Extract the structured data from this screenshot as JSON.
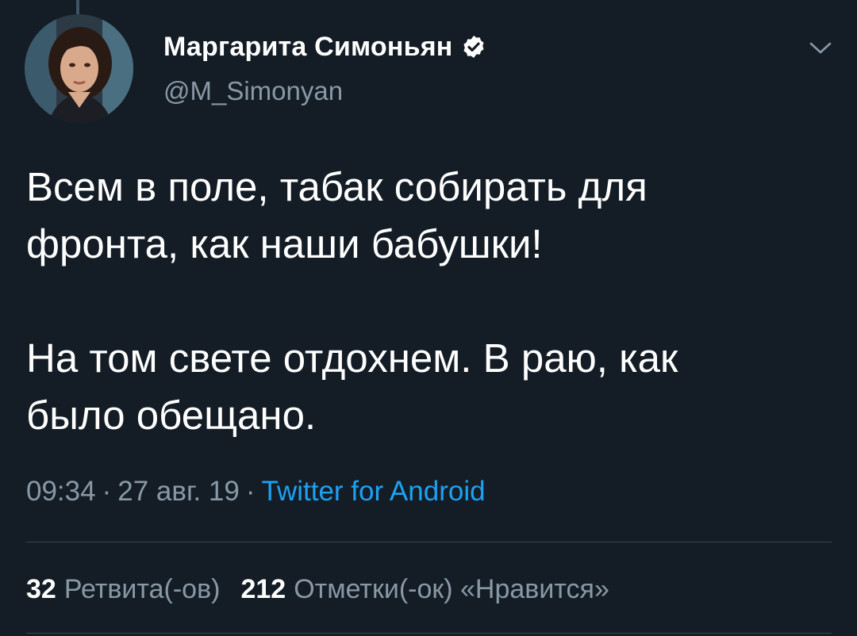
{
  "user": {
    "display_name": "Маргарита Симоньян",
    "handle": "@M_Simonyan",
    "verified": true
  },
  "tweet": {
    "paragraphs": [
      [
        "Всем в поле, табак собирать для",
        "фронта, как наши бабушки!"
      ],
      [
        "На том свете отдохнем. В раю, как",
        "было обещано."
      ]
    ]
  },
  "meta": {
    "time": "09:34",
    "date": "27 авг. 19",
    "separator": "·",
    "source": "Twitter for Android"
  },
  "stats": {
    "retweets_count": "32",
    "retweets_label": "Ретвита(-ов)",
    "likes_count": "212",
    "likes_label": "Отметки(-ок) «Нравится»"
  },
  "colors": {
    "background": "#141d26",
    "text": "#ffffff",
    "secondary": "#8899a6",
    "link": "#1da1f2",
    "divider": "#38444d"
  },
  "icons": {
    "verified": "verified-badge-icon",
    "menu": "chevron-down-icon"
  }
}
